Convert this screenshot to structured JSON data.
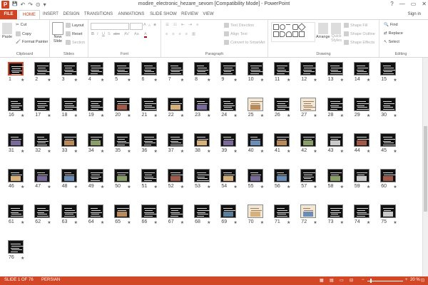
{
  "window": {
    "title": "modire_electronic_hezare_sevom [Compatibility Mode] - PowerPoint",
    "app_icon_letter": "P",
    "controls": [
      "?",
      "—",
      "▭",
      "✕"
    ]
  },
  "quick_access": {
    "save": "💾",
    "undo": "↶",
    "redo": "↷",
    "start": "⊙",
    "more": "▾"
  },
  "tabs": [
    {
      "label": "FILE"
    },
    {
      "label": "HOME"
    },
    {
      "label": "INSERT"
    },
    {
      "label": "DESIGN"
    },
    {
      "label": "TRANSITIONS"
    },
    {
      "label": "ANIMATIONS"
    },
    {
      "label": "SLIDE SHOW"
    },
    {
      "label": "REVIEW"
    },
    {
      "label": "VIEW"
    }
  ],
  "sign_in": "Sign in",
  "ribbon": {
    "clipboard": {
      "paste": "Paste",
      "cut": "Cut",
      "copy": "Copy",
      "format_painter": "Format Painter",
      "label": "Clipboard"
    },
    "slides": {
      "new_slide_1": "New",
      "new_slide_2": "Slide",
      "layout": "Layout",
      "reset": "Reset",
      "section": "Section",
      "label": "Slides"
    },
    "font": {
      "label": "Font",
      "bold": "B",
      "italic": "I",
      "underline": "U",
      "strike": "S",
      "abc": "abc",
      "spacing": "AV",
      "case": "Aa",
      "grow": "A",
      "shrink": "A"
    },
    "paragraph": {
      "text_direction": "Text Direction",
      "align_text": "Align Text",
      "convert_smartart": "Convert to SmartArt",
      "label": "Paragraph"
    },
    "drawing": {
      "arrange": "Arrange",
      "quick_styles_1": "Quick",
      "quick_styles_2": "Styles",
      "shape_fill": "Shape Fill",
      "shape_outline": "Shape Outline",
      "shape_effects": "Shape Effects",
      "label": "Drawing"
    },
    "editing": {
      "find": "Find",
      "replace": "Replace",
      "select": "Select",
      "label": "Editing"
    }
  },
  "slides": {
    "selected": 1,
    "star": "★",
    "numbers": [
      "1",
      "2",
      "3",
      "4",
      "5",
      "6",
      "7",
      "8",
      "9",
      "10",
      "11",
      "12",
      "13",
      "14",
      "15",
      "16",
      "17",
      "18",
      "19",
      "20",
      "21",
      "22",
      "23",
      "24",
      "25",
      "26",
      "27",
      "28",
      "29",
      "30",
      "31",
      "32",
      "33",
      "34",
      "35",
      "36",
      "37",
      "38",
      "39",
      "40",
      "41",
      "42",
      "43",
      "44",
      "45",
      "46",
      "47",
      "48",
      "49",
      "50",
      "51",
      "52",
      "53",
      "54",
      "55",
      "56",
      "57",
      "58",
      "59",
      "60",
      "61",
      "62",
      "63",
      "64",
      "65",
      "66",
      "67",
      "68",
      "69",
      "70",
      "71",
      "72",
      "73",
      "74",
      "75",
      "76"
    ],
    "image_slides": [
      20,
      22,
      23,
      25,
      31,
      33,
      34,
      38,
      39,
      40,
      41,
      42,
      43,
      44,
      46,
      47,
      48,
      50,
      52,
      54,
      55,
      56,
      58,
      59,
      60,
      65,
      69,
      70,
      72,
      75
    ],
    "light_slides": [
      25,
      27,
      70,
      72
    ]
  },
  "status": {
    "slide_info": "SLIDE 1 OF 76",
    "language": "PERSIAN",
    "view_icons": [
      "▦",
      "▤",
      "▭",
      "⊟"
    ],
    "zoom_minus": "−",
    "zoom_plus": "+",
    "zoom": "20 %",
    "fit_icon": "⊡"
  },
  "colors": {
    "accent": "#d24726",
    "slide_bg": "#111111"
  }
}
